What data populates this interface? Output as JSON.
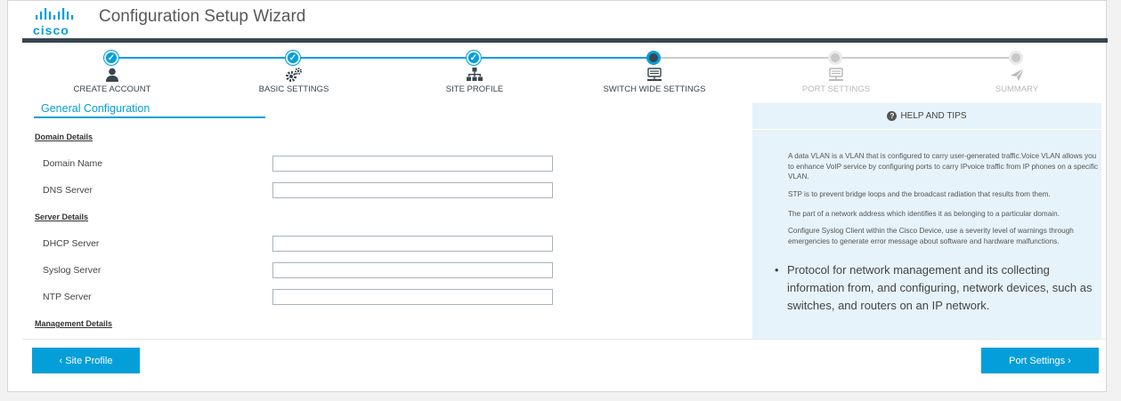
{
  "header": {
    "logo_text": "cisco",
    "title": "Configuration Setup Wizard"
  },
  "wizard": {
    "steps": [
      {
        "label": "CREATE ACCOUNT",
        "status": "done",
        "icon": "user-icon"
      },
      {
        "label": "BASIC SETTINGS",
        "status": "done",
        "icon": "gears-icon"
      },
      {
        "label": "SITE PROFILE",
        "status": "done",
        "icon": "sitemap-icon"
      },
      {
        "label": "SWITCH WIDE SETTINGS",
        "status": "current",
        "icon": "switch-icon"
      },
      {
        "label": "PORT SETTINGS",
        "status": "pending",
        "icon": "port-icon"
      },
      {
        "label": "SUMMARY",
        "status": "pending",
        "icon": "send-icon"
      }
    ],
    "check_glyph": "✓"
  },
  "section": {
    "title": "General Configuration"
  },
  "form": {
    "domain_details": "Domain Details",
    "domain_name_label": "Domain Name",
    "domain_name_value": "",
    "dns_server_label": "DNS Server",
    "dns_server_value": "",
    "server_details": "Server Details",
    "dhcp_server_label": "DHCP Server",
    "dhcp_server_value": "",
    "syslog_server_label": "Syslog Server",
    "syslog_server_value": "",
    "ntp_server_label": "NTP Server",
    "ntp_server_value": "",
    "management_details": "Management Details"
  },
  "help": {
    "title": "HELP AND TIPS",
    "icon_glyph": "?",
    "paragraphs": [
      "A data VLAN is a VLAN that is configured to carry user-generated traffic.Voice VLAN allows you to enhance VoIP service by configuring ports to carry IPvoice traffic from IP phones on a specific VLAN.",
      "STP is to prevent bridge loops and the broadcast radiation that results from them.",
      "The part of a network address which identifies it as belonging to a particular domain.",
      "Configure Syslog Client within the Cisco Device, use a severity level of warnings through emergencies to generate error message about software and hardware malfunctions."
    ],
    "bullet_glyph": "•",
    "bullet": "Protocol for network management and its collecting information from, and configuring, network devices, such as switches, and routers on an IP network."
  },
  "footer": {
    "back_label": "‹ Site Profile",
    "next_label": "Port Settings ›"
  },
  "colors": {
    "accent": "#049fd9",
    "dark": "#39454f",
    "pending": "#c8c8c8",
    "help_bg": "#e6f3fa"
  }
}
